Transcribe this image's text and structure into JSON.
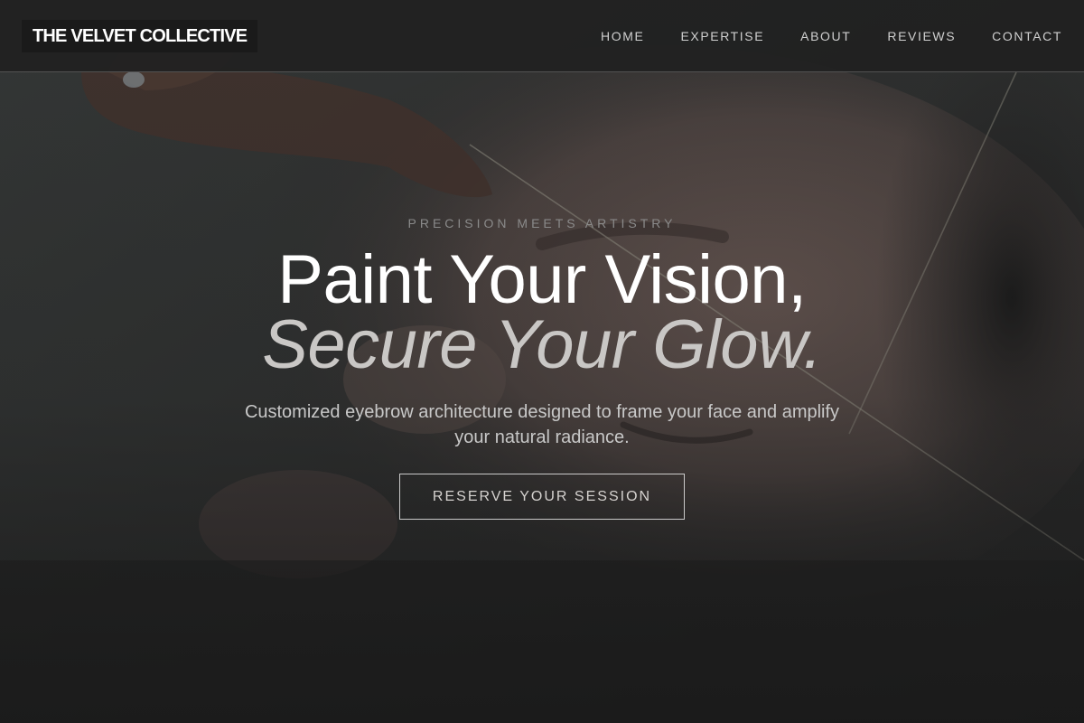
{
  "brand": "THE VELVET COLLECTIVE",
  "nav": {
    "items": [
      {
        "label": "HOME"
      },
      {
        "label": "EXPERTISE"
      },
      {
        "label": "ABOUT"
      },
      {
        "label": "REVIEWS"
      },
      {
        "label": "CONTACT"
      }
    ]
  },
  "hero": {
    "eyebrow": "PRECISION MEETS ARTISTRY",
    "headline_line1": "Paint Your Vision,",
    "headline_line2": "Secure Your Glow.",
    "subtext": "Customized eyebrow architecture designed to frame your face and amplify your natural radiance.",
    "cta_label": "RESERVE YOUR SESSION"
  },
  "colors": {
    "navbar_bg": "#212121",
    "text_primary": "#ffffff",
    "text_secondary": "#c9c7c5",
    "eyebrow": "#8a8a8a"
  }
}
